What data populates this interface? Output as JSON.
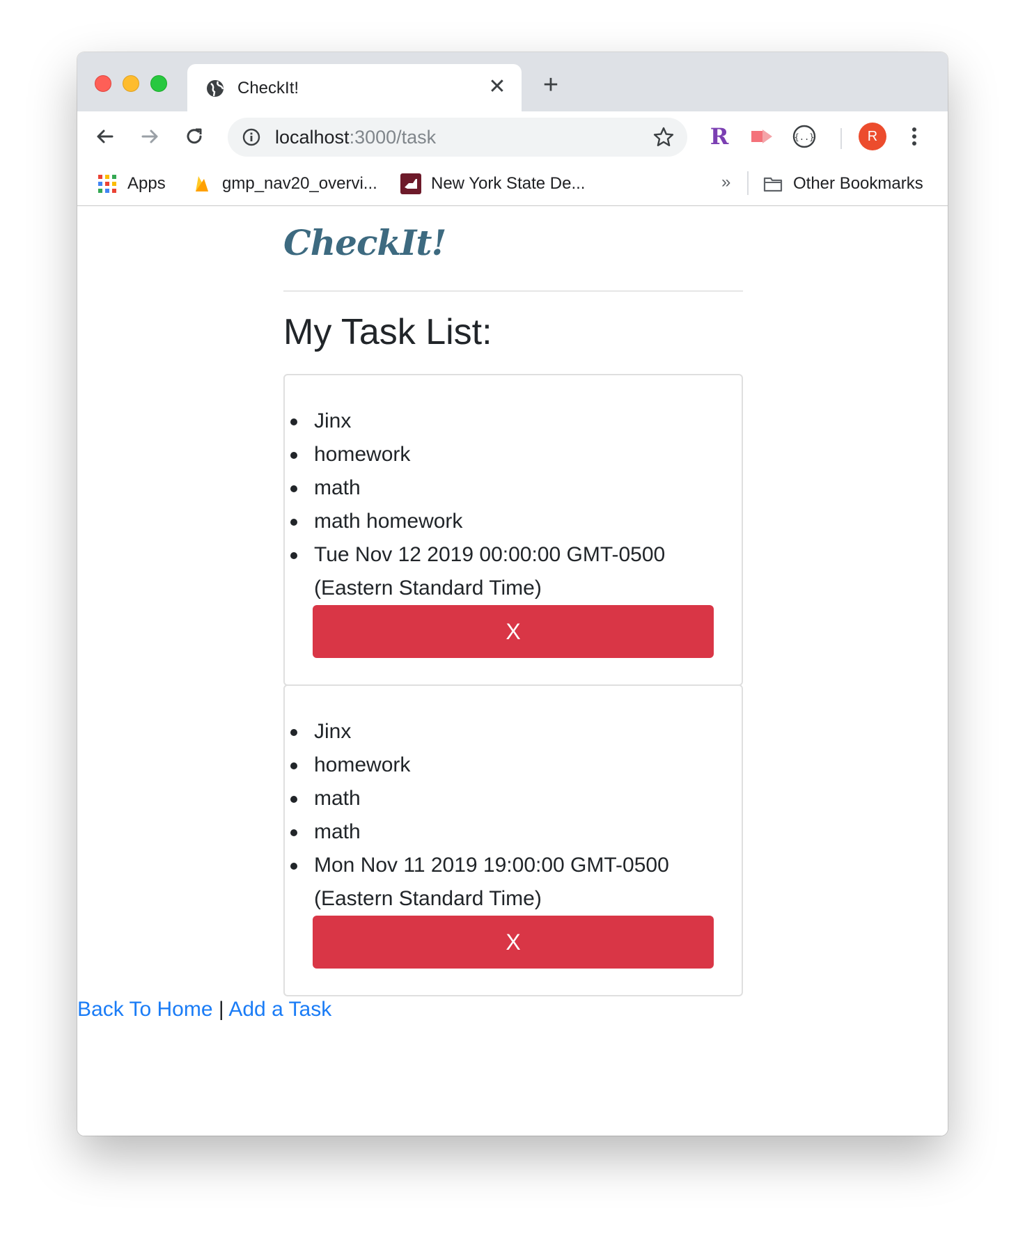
{
  "browser": {
    "tab_title": "CheckIt!",
    "tab_close": "✕",
    "new_tab": "+",
    "url_host": "localhost",
    "url_rest": ":3000/task",
    "avatar_letter": "R",
    "bookmarks": [
      {
        "label": "Apps",
        "icon": "apps-grid-icon"
      },
      {
        "label": "gmp_nav20_overvi...",
        "icon": "firebase-icon"
      },
      {
        "label": "New York State De...",
        "icon": "nys-icon"
      }
    ],
    "bookmarks_overflow": "»",
    "other_bookmarks": "Other Bookmarks"
  },
  "page": {
    "brand": "CheckIt!",
    "heading": "My Task List:",
    "tasks": [
      {
        "items": [
          "Jinx",
          "homework",
          "math",
          "math homework"
        ],
        "date": "Tue Nov 12 2019 00:00:00 GMT-0500 (Eastern Standard Time)",
        "delete_label": "X"
      },
      {
        "items": [
          "Jinx",
          "homework",
          "math",
          "math"
        ],
        "date": "Mon Nov 11 2019 19:00:00 GMT-0500 (Eastern Standard Time)",
        "delete_label": "X"
      }
    ],
    "links": {
      "home": "Back To Home",
      "separator": "|",
      "add": "Add a Task"
    }
  },
  "colors": {
    "brand": "#3d6a80",
    "danger": "#d93646",
    "link": "#1a7cf6"
  }
}
